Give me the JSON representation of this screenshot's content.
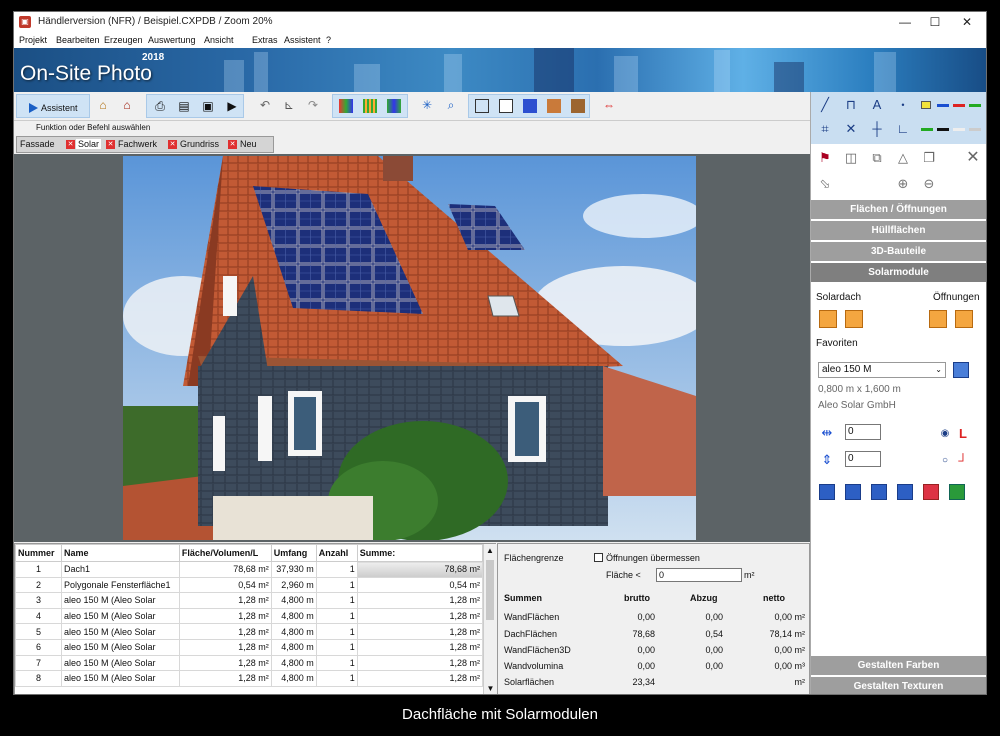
{
  "window": {
    "title": "Händlerversion (NFR) / Beispiel.CXPDB / Zoom 20%",
    "minimize": "—",
    "maximize": "☐",
    "close": "✕"
  },
  "menu": [
    "Projekt",
    "Bearbeiten",
    "Erzeugen",
    "Auswertung",
    "Ansicht",
    "Extras",
    "Assistent",
    "?"
  ],
  "banner": {
    "logo": "On-Site Photo",
    "year": "2018"
  },
  "toolbar": {
    "assistant": "Assistent"
  },
  "status": "Funktion oder Befehl auswählen",
  "tabs": [
    "Fassade",
    "Solar",
    "Fachwerk",
    "Grundriss",
    "Neu"
  ],
  "side": {
    "buttons": [
      "Flächen / Öffnungen",
      "Hüllflächen",
      "3D-Bauteile",
      "Solarmodule"
    ],
    "solardach": "Solardach",
    "oeffnungen": "Öffnungen",
    "favoriten": "Favoriten",
    "fav_selected": "aleo 150 M",
    "dims": "0,800 m x 1,600 m",
    "maker": "Aleo Solar GmbH",
    "input1": "0",
    "input2": "0",
    "bottom": [
      "Gestalten Farben",
      "Gestalten Texturen"
    ]
  },
  "table": {
    "headers": [
      "Nummer",
      "Name",
      "Fläche/Volumen/L",
      "Umfang",
      "Anzahl",
      "Summe:"
    ],
    "rows": [
      [
        "1",
        "Dach1",
        "78,68 m²",
        "37,930 m",
        "1",
        "78,68 m²"
      ],
      [
        "2",
        "Polygonale Fensterfläche1",
        "0,54 m²",
        "2,960 m",
        "1",
        "0,54 m²"
      ],
      [
        "3",
        "aleo 150 M (Aleo Solar",
        "1,28 m²",
        "4,800 m",
        "1",
        "1,28 m²"
      ],
      [
        "4",
        "aleo 150 M (Aleo Solar",
        "1,28 m²",
        "4,800 m",
        "1",
        "1,28 m²"
      ],
      [
        "5",
        "aleo 150 M (Aleo Solar",
        "1,28 m²",
        "4,800 m",
        "1",
        "1,28 m²"
      ],
      [
        "6",
        "aleo 150 M (Aleo Solar",
        "1,28 m²",
        "4,800 m",
        "1",
        "1,28 m²"
      ],
      [
        "7",
        "aleo 150 M (Aleo Solar",
        "1,28 m²",
        "4,800 m",
        "1",
        "1,28 m²"
      ],
      [
        "8",
        "aleo 150 M (Aleo Solar",
        "1,28 m²",
        "4,800 m",
        "1",
        "1,28 m²"
      ]
    ]
  },
  "summary": {
    "flaechengrenze": "Flächengrenze",
    "oeffnungen_check": "Öffnungen übermessen",
    "flaeche_lt": "Fläche <",
    "flaeche_val": "0",
    "unit": "m²",
    "headers": [
      "Summen",
      "brutto",
      "Abzug",
      "netto"
    ],
    "rows": [
      [
        "WandFlächen",
        "0,00",
        "0,00",
        "0,00 m²"
      ],
      [
        "DachFlächen",
        "78,68",
        "0,54",
        "78,14 m²"
      ],
      [
        "WandFlächen3D",
        "0,00",
        "0,00",
        "0,00 m²"
      ],
      [
        "Wandvolumina",
        "0,00",
        "0,00",
        "0,00 m³"
      ],
      [
        "Solarflächen",
        "23,34",
        "",
        "m²"
      ]
    ]
  },
  "caption": "Dachfläche mit Solarmodulen"
}
